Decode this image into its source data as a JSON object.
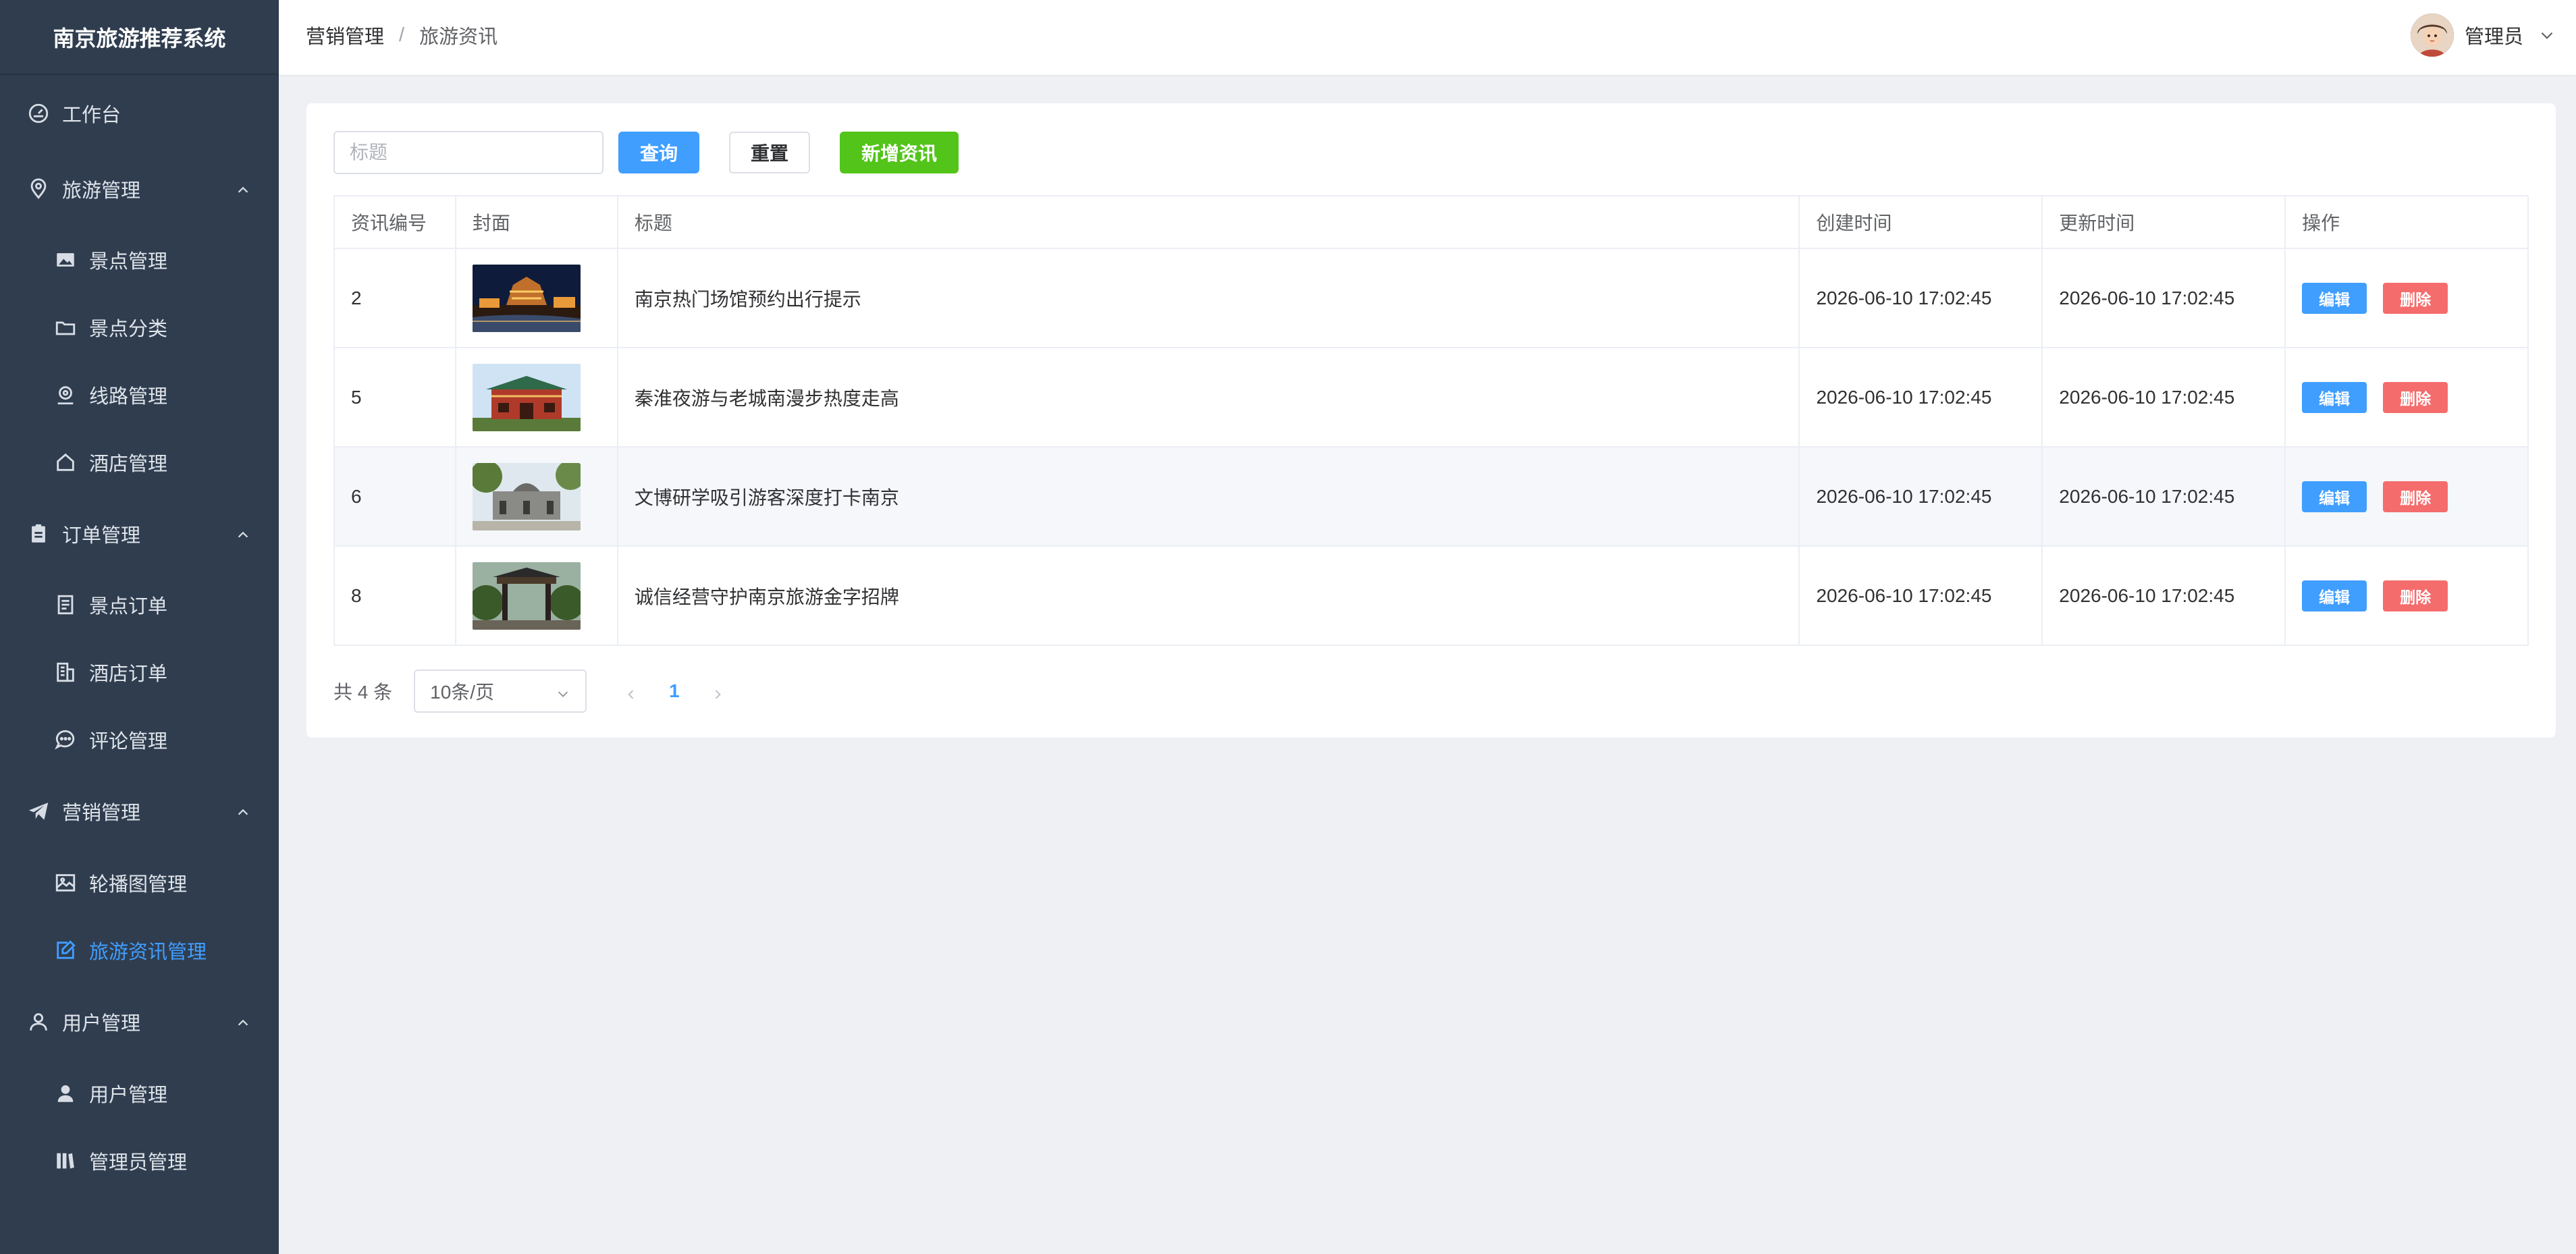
{
  "sidebar": {
    "title": "南京旅游推荐系统",
    "workbench": "工作台",
    "groups": [
      {
        "label": "旅游管理",
        "items": [
          "景点管理",
          "景点分类",
          "线路管理",
          "酒店管理"
        ]
      },
      {
        "label": "订单管理",
        "items": [
          "景点订单",
          "酒店订单",
          "评论管理"
        ]
      },
      {
        "label": "营销管理",
        "items": [
          "轮播图管理",
          "旅游资讯管理"
        ]
      },
      {
        "label": "用户管理",
        "items": [
          "用户管理",
          "管理员管理"
        ]
      }
    ],
    "active_item": "旅游资讯管理",
    "active_color": "#409eff"
  },
  "header": {
    "breadcrumb": [
      "营销管理",
      "旅游资讯"
    ],
    "separator": "/",
    "user_name": "管理员"
  },
  "toolbar": {
    "search_placeholder": "标题",
    "query_label": "查询",
    "reset_label": "重置",
    "add_label": "新增资讯"
  },
  "table": {
    "columns": [
      "资讯编号",
      "封面",
      "标题",
      "创建时间",
      "更新时间",
      "操作"
    ],
    "rows": [
      {
        "id": "2",
        "title": "南京热门场馆预约出行提示",
        "created": "2026-06-10 17:02:45",
        "updated": "2026-06-10 17:02:45"
      },
      {
        "id": "5",
        "title": "秦淮夜游与老城南漫步热度走高",
        "created": "2026-06-10 17:02:45",
        "updated": "2026-06-10 17:02:45"
      },
      {
        "id": "6",
        "title": "文博研学吸引游客深度打卡南京",
        "created": "2026-06-10 17:02:45",
        "updated": "2026-06-10 17:02:45"
      },
      {
        "id": "8",
        "title": "诚信经营守护南京旅游金字招牌",
        "created": "2026-06-10 17:02:45",
        "updated": "2026-06-10 17:02:45"
      }
    ],
    "edit_label": "编辑",
    "delete_label": "删除"
  },
  "pagination": {
    "total_text": "共 4 条",
    "page_size": "10条/页",
    "current_page": "1"
  }
}
